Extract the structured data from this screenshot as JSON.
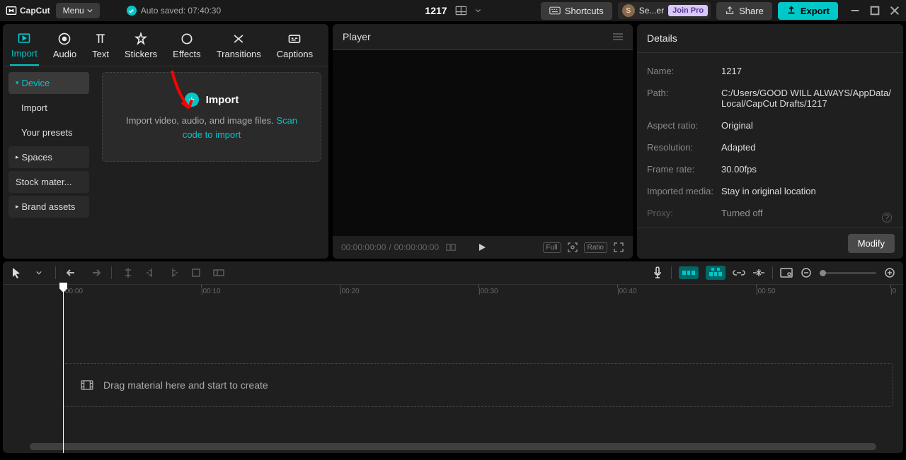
{
  "titlebar": {
    "app_name": "CapCut",
    "menu_label": "Menu",
    "autosave_label": "Auto saved: 07:40:30",
    "project_title": "1217",
    "shortcuts_label": "Shortcuts",
    "user_initial": "S",
    "user_name": "Se...er",
    "join_pro_label": "Join Pro",
    "share_label": "Share",
    "export_label": "Export"
  },
  "tool_tabs": {
    "import": "Import",
    "audio": "Audio",
    "text": "Text",
    "stickers": "Stickers",
    "effects": "Effects",
    "transitions": "Transitions",
    "captions": "Captions"
  },
  "sidebar": {
    "device": "Device",
    "import": "Import",
    "presets": "Your presets",
    "spaces": "Spaces",
    "stock": "Stock mater...",
    "brand": "Brand assets"
  },
  "import_zone": {
    "title": "Import",
    "desc_pre": "Import video, audio, and image files. ",
    "scan_link": "Scan code to import"
  },
  "player": {
    "title": "Player",
    "current_time": "00:00:00:00",
    "sep": " / ",
    "total_time": "00:00:00:00",
    "full_label": "Full",
    "ratio_label": "Ratio"
  },
  "details": {
    "title": "Details",
    "rows": {
      "name_label": "Name:",
      "name_value": "1217",
      "path_label": "Path:",
      "path_value": "C:/Users/GOOD WILL ALWAYS/AppData/Local/CapCut Drafts/1217",
      "aspect_label": "Aspect ratio:",
      "aspect_value": "Original",
      "resolution_label": "Resolution:",
      "resolution_value": "Adapted",
      "framerate_label": "Frame rate:",
      "framerate_value": "30.00fps",
      "imported_label": "Imported media:",
      "imported_value": "Stay in original location",
      "proxy_label": "Proxy:",
      "proxy_value": "Turned off"
    },
    "modify_label": "Modify"
  },
  "timeline": {
    "drop_hint": "Drag material here and start to create",
    "ruler": [
      "00:00",
      "|00:10",
      "|00:20",
      "|00:30",
      "|00:40",
      "|00:50",
      "|0"
    ]
  }
}
